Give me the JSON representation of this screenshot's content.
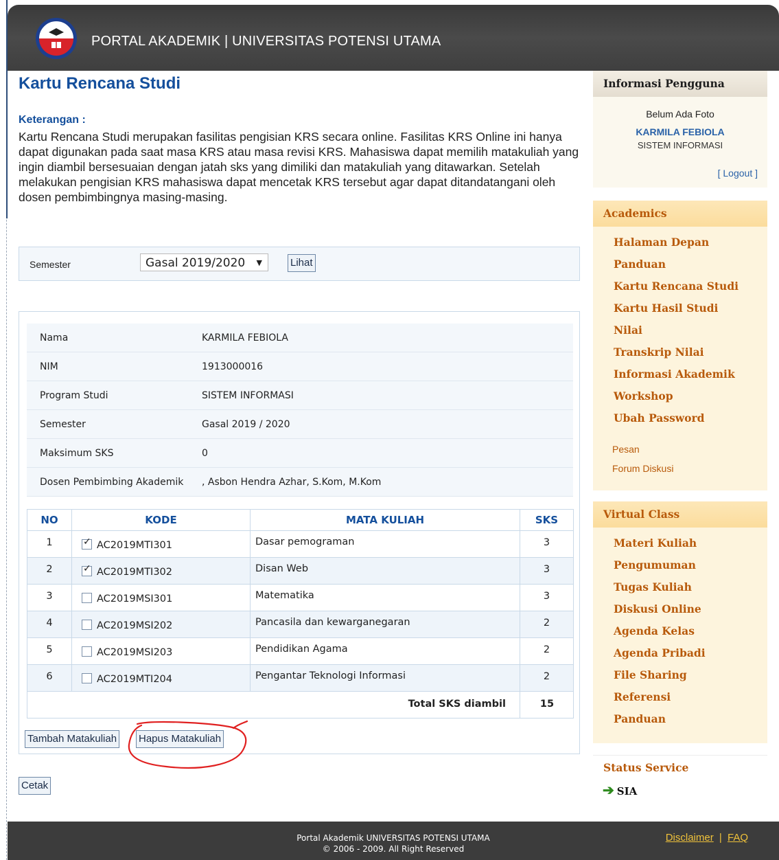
{
  "header": {
    "site_title": "PORTAL AKADEMIK | UNIVERSITAS POTENSI UTAMA"
  },
  "main": {
    "title": "Kartu Rencana Studi",
    "keterangan_label": "Keterangan :",
    "keterangan_text": "Kartu Rencana Studi merupakan fasilitas pengisian KRS secara online. Fasilitas KRS Online ini hanya dapat digunakan pada saat masa KRS atau masa revisi KRS. Mahasiswa dapat memilih matakuliah yang ingin diambil bersesuaian dengan jatah sks yang dimiliki dan matakuliah yang ditawarkan. Setelah melakukan pengisian KRS mahasiswa dapat mencetak KRS tersebut agar dapat ditandatangani oleh dosen pembimbingnya masing-masing.",
    "semester_label": "Semester",
    "semester_selected": "Gasal 2019/2020",
    "lihat_button": "Lihat",
    "info": [
      {
        "label": "Nama",
        "value": "KARMILA FEBIOLA"
      },
      {
        "label": "NIM",
        "value": "1913000016"
      },
      {
        "label": "Program Studi",
        "value": "SISTEM INFORMASI"
      },
      {
        "label": "Semester",
        "value": "Gasal 2019 / 2020"
      },
      {
        "label": "Maksimum SKS",
        "value": "0"
      },
      {
        "label": "Dosen Pembimbing Akademik",
        "value": ", Asbon Hendra Azhar, S.Kom, M.Kom"
      }
    ],
    "table": {
      "headers": {
        "no": "NO",
        "kode": "KODE",
        "mata_kuliah": "MATA KULIAH",
        "sks": "SKS"
      },
      "rows": [
        {
          "no": "1",
          "checked": true,
          "kode": "AC2019MTI301",
          "mata_kuliah": "Dasar pemograman",
          "sks": "3"
        },
        {
          "no": "2",
          "checked": true,
          "kode": "AC2019MTI302",
          "mata_kuliah": "Disan Web",
          "sks": "3"
        },
        {
          "no": "3",
          "checked": false,
          "kode": "AC2019MSI301",
          "mata_kuliah": "Matematika",
          "sks": "3"
        },
        {
          "no": "4",
          "checked": false,
          "kode": "AC2019MSI202",
          "mata_kuliah": "Pancasila dan kewarganegaran",
          "sks": "2"
        },
        {
          "no": "5",
          "checked": false,
          "kode": "AC2019MSI203",
          "mata_kuliah": "Pendidikan Agama",
          "sks": "2"
        },
        {
          "no": "6",
          "checked": false,
          "kode": "AC2019MTI204",
          "mata_kuliah": "Pengantar Teknologi Informasi",
          "sks": "2"
        }
      ],
      "total_label": "Total SKS diambil",
      "total_value": "15"
    },
    "tambah_button": "Tambah Matakuliah",
    "hapus_button": "Hapus Matakuliah",
    "cetak_button": "Cetak",
    "annotation_color": "#e02020"
  },
  "sidebar": {
    "user": {
      "title": "Informasi Pengguna",
      "photo_text": "Belum Ada Foto",
      "name": "KARMILA FEBIOLA",
      "program": "SISTEM INFORMASI",
      "logout": "[ Logout ]"
    },
    "academics": {
      "title": "Academics",
      "links": [
        "Halaman Depan",
        "Panduan",
        "Kartu Rencana Studi",
        "Kartu Hasil Studi",
        "Nilai",
        "Transkrip Nilai",
        "Informasi Akademik",
        "Workshop",
        "Ubah Password"
      ],
      "plain_links": [
        "Pesan",
        "Forum Diskusi"
      ]
    },
    "virtual_class": {
      "title": "Virtual Class",
      "links": [
        "Materi Kuliah",
        "Pengumuman",
        "Tugas Kuliah",
        "Diskusi Online",
        "Agenda Kelas",
        "Agenda Pribadi",
        "File Sharing",
        "Referensi",
        "Panduan"
      ]
    },
    "status": {
      "title": "Status Service",
      "item": "SIA",
      "arrow_icon": "right-arrow-icon"
    }
  },
  "footer": {
    "line1": "Portal Akademik UNIVERSITAS POTENSI UTAMA",
    "line2": "© 2006 - 2009. All Right Reserved",
    "disclaimer": "Disclaimer",
    "separator": "|",
    "faq": "FAQ"
  }
}
